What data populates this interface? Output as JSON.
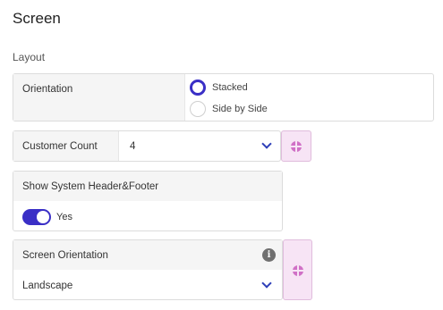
{
  "header": {
    "title": "Screen",
    "section": "Layout"
  },
  "orientation": {
    "label": "Orientation",
    "options": [
      {
        "label": "Stacked",
        "selected": true
      },
      {
        "label": "Side by Side",
        "selected": false
      }
    ]
  },
  "customer_count": {
    "label": "Customer Count",
    "value": "4"
  },
  "show_header_footer": {
    "label": "Show System Header&Footer",
    "toggle_label": "Yes",
    "enabled": true
  },
  "screen_orientation": {
    "label": "Screen Orientation",
    "info": "i",
    "value": "Landscape"
  },
  "colors": {
    "accent": "#3a2fc6",
    "globe": "#d070c6",
    "globe_bg": "#f7e4f5"
  },
  "icons": [
    "radio-checked",
    "chevron-down-icon",
    "globe-icon",
    "info-icon"
  ]
}
